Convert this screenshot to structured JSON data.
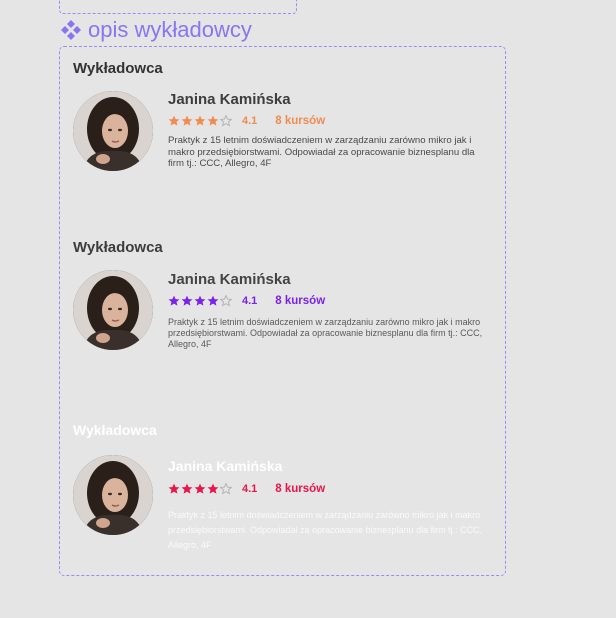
{
  "component": {
    "title": "opis wykładowcy",
    "icon": "component-icon",
    "accent_color": "#8b74f0"
  },
  "variants": [
    {
      "heading": "Wykładowca",
      "name": "Janina Kamińska",
      "rating": 4,
      "rating_label": "4.1",
      "max_stars": 5,
      "courses": "8 kursów",
      "description": "Praktyk z 15 letnim doświadczeniem w zarządzaniu zarówno mikro jak i makro przedsiębiorstwami. Odpowiadał za opracowanie biznesplanu dla firm tj.: CCC, Allegro, 4F",
      "star_color": "#f08c4f"
    },
    {
      "heading": "Wykładowca",
      "name": "Janina Kamińska",
      "rating": 4,
      "rating_label": "4.1",
      "max_stars": 5,
      "courses": "8 kursów",
      "description": "Praktyk z 15 letnim doświadczeniem w zarządzaniu zarówno mikro jak i makro przedsiębiorstwami. Odpowiadał za opracowanie biznesplanu dla firm tj.: CCC, Allegro, 4F",
      "star_color": "#7b22e6"
    },
    {
      "heading": "Wykładowca",
      "name": "Janina Kamińska",
      "rating": 4,
      "rating_label": "4.1",
      "max_stars": 5,
      "courses": "8 kursów",
      "description": "Praktyk z 15 letnim doświadczeniem w zarządzaniu zarówno mikro jak i makro przedsiębiorstwami. Odpowiadał za opracowanie biznesplanu dla firm tj.: CCC, Allegro, 4F",
      "star_color": "#e8154a"
    }
  ]
}
